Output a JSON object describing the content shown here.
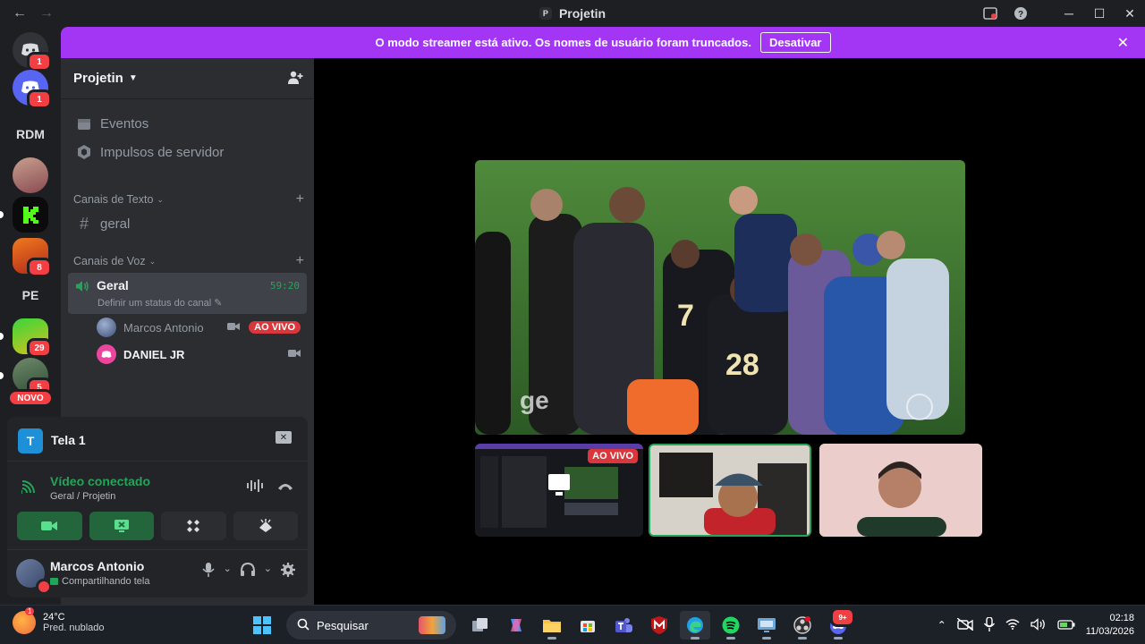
{
  "titlebar": {
    "back": "←",
    "forward": "→",
    "server_initial": "P",
    "title": "Projetin"
  },
  "rail": {
    "home_badge": "1",
    "discord_badge": "1",
    "rdm_label": "RDM",
    "pe_label": "PE",
    "mamba_badge": "8",
    "t_badge": "29",
    "s_badge": "5",
    "novo_label": "NOVO"
  },
  "banner": {
    "message": "O modo streamer está ativo. Os nomes de usuário foram truncados.",
    "button": "Desativar"
  },
  "sidebar": {
    "server_name": "Projetin",
    "events": "Eventos",
    "boosts": "Impulsos de servidor",
    "text_category": "Canais de Texto",
    "text_channel": "geral",
    "voice_category": "Canais de Voz",
    "voice_channel": "Geral",
    "voice_timer": "59:20",
    "voice_status": "Definir um status do canal",
    "members": [
      {
        "name": "Marcos Antonio",
        "live": "AO VIVO"
      },
      {
        "name": "DANIEL JR"
      }
    ]
  },
  "panel": {
    "stream_name": "Tela 1",
    "stream_icon_letter": "T",
    "connection_title": "Vídeo conectado",
    "connection_sub": "Geral / Projetin",
    "user_name": "Marcos Antonio",
    "user_status": "Compartilhando tela"
  },
  "stage": {
    "tile_live": "AO VIVO"
  },
  "taskbar": {
    "temperature": "24°C",
    "condition": "Pred. nublado",
    "weather_badge": "1",
    "search_placeholder": "Pesquisar",
    "time": "02:18",
    "date": "11/03/2026",
    "discord_badge": "9+"
  }
}
